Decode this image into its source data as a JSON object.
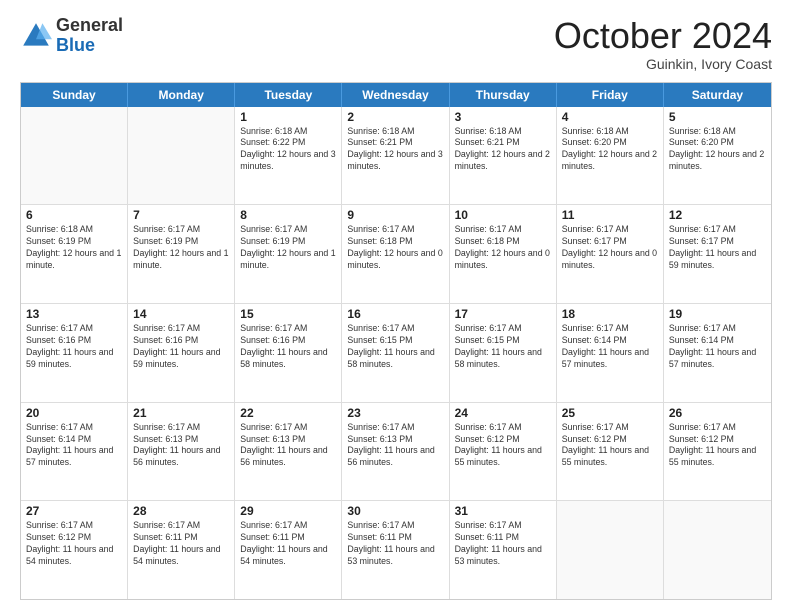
{
  "header": {
    "logo_general": "General",
    "logo_blue": "Blue",
    "month_title": "October 2024",
    "location": "Guinkin, Ivory Coast"
  },
  "days_of_week": [
    "Sunday",
    "Monday",
    "Tuesday",
    "Wednesday",
    "Thursday",
    "Friday",
    "Saturday"
  ],
  "weeks": [
    [
      {
        "day": "",
        "info": ""
      },
      {
        "day": "",
        "info": ""
      },
      {
        "day": "1",
        "info": "Sunrise: 6:18 AM\nSunset: 6:22 PM\nDaylight: 12 hours and 3 minutes."
      },
      {
        "day": "2",
        "info": "Sunrise: 6:18 AM\nSunset: 6:21 PM\nDaylight: 12 hours and 3 minutes."
      },
      {
        "day": "3",
        "info": "Sunrise: 6:18 AM\nSunset: 6:21 PM\nDaylight: 12 hours and 2 minutes."
      },
      {
        "day": "4",
        "info": "Sunrise: 6:18 AM\nSunset: 6:20 PM\nDaylight: 12 hours and 2 minutes."
      },
      {
        "day": "5",
        "info": "Sunrise: 6:18 AM\nSunset: 6:20 PM\nDaylight: 12 hours and 2 minutes."
      }
    ],
    [
      {
        "day": "6",
        "info": "Sunrise: 6:18 AM\nSunset: 6:19 PM\nDaylight: 12 hours and 1 minute."
      },
      {
        "day": "7",
        "info": "Sunrise: 6:17 AM\nSunset: 6:19 PM\nDaylight: 12 hours and 1 minute."
      },
      {
        "day": "8",
        "info": "Sunrise: 6:17 AM\nSunset: 6:19 PM\nDaylight: 12 hours and 1 minute."
      },
      {
        "day": "9",
        "info": "Sunrise: 6:17 AM\nSunset: 6:18 PM\nDaylight: 12 hours and 0 minutes."
      },
      {
        "day": "10",
        "info": "Sunrise: 6:17 AM\nSunset: 6:18 PM\nDaylight: 12 hours and 0 minutes."
      },
      {
        "day": "11",
        "info": "Sunrise: 6:17 AM\nSunset: 6:17 PM\nDaylight: 12 hours and 0 minutes."
      },
      {
        "day": "12",
        "info": "Sunrise: 6:17 AM\nSunset: 6:17 PM\nDaylight: 11 hours and 59 minutes."
      }
    ],
    [
      {
        "day": "13",
        "info": "Sunrise: 6:17 AM\nSunset: 6:16 PM\nDaylight: 11 hours and 59 minutes."
      },
      {
        "day": "14",
        "info": "Sunrise: 6:17 AM\nSunset: 6:16 PM\nDaylight: 11 hours and 59 minutes."
      },
      {
        "day": "15",
        "info": "Sunrise: 6:17 AM\nSunset: 6:16 PM\nDaylight: 11 hours and 58 minutes."
      },
      {
        "day": "16",
        "info": "Sunrise: 6:17 AM\nSunset: 6:15 PM\nDaylight: 11 hours and 58 minutes."
      },
      {
        "day": "17",
        "info": "Sunrise: 6:17 AM\nSunset: 6:15 PM\nDaylight: 11 hours and 58 minutes."
      },
      {
        "day": "18",
        "info": "Sunrise: 6:17 AM\nSunset: 6:14 PM\nDaylight: 11 hours and 57 minutes."
      },
      {
        "day": "19",
        "info": "Sunrise: 6:17 AM\nSunset: 6:14 PM\nDaylight: 11 hours and 57 minutes."
      }
    ],
    [
      {
        "day": "20",
        "info": "Sunrise: 6:17 AM\nSunset: 6:14 PM\nDaylight: 11 hours and 57 minutes."
      },
      {
        "day": "21",
        "info": "Sunrise: 6:17 AM\nSunset: 6:13 PM\nDaylight: 11 hours and 56 minutes."
      },
      {
        "day": "22",
        "info": "Sunrise: 6:17 AM\nSunset: 6:13 PM\nDaylight: 11 hours and 56 minutes."
      },
      {
        "day": "23",
        "info": "Sunrise: 6:17 AM\nSunset: 6:13 PM\nDaylight: 11 hours and 56 minutes."
      },
      {
        "day": "24",
        "info": "Sunrise: 6:17 AM\nSunset: 6:12 PM\nDaylight: 11 hours and 55 minutes."
      },
      {
        "day": "25",
        "info": "Sunrise: 6:17 AM\nSunset: 6:12 PM\nDaylight: 11 hours and 55 minutes."
      },
      {
        "day": "26",
        "info": "Sunrise: 6:17 AM\nSunset: 6:12 PM\nDaylight: 11 hours and 55 minutes."
      }
    ],
    [
      {
        "day": "27",
        "info": "Sunrise: 6:17 AM\nSunset: 6:12 PM\nDaylight: 11 hours and 54 minutes."
      },
      {
        "day": "28",
        "info": "Sunrise: 6:17 AM\nSunset: 6:11 PM\nDaylight: 11 hours and 54 minutes."
      },
      {
        "day": "29",
        "info": "Sunrise: 6:17 AM\nSunset: 6:11 PM\nDaylight: 11 hours and 54 minutes."
      },
      {
        "day": "30",
        "info": "Sunrise: 6:17 AM\nSunset: 6:11 PM\nDaylight: 11 hours and 53 minutes."
      },
      {
        "day": "31",
        "info": "Sunrise: 6:17 AM\nSunset: 6:11 PM\nDaylight: 11 hours and 53 minutes."
      },
      {
        "day": "",
        "info": ""
      },
      {
        "day": "",
        "info": ""
      }
    ]
  ]
}
